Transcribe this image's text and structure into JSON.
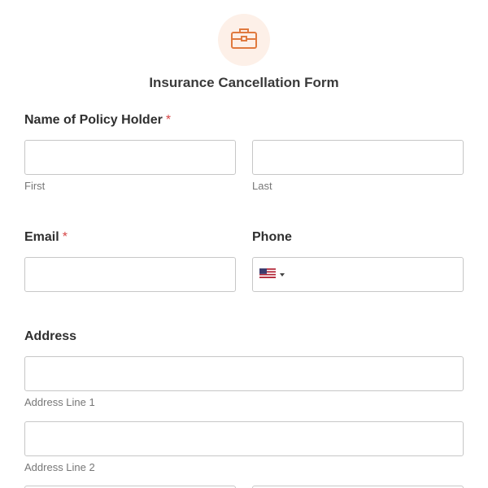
{
  "header": {
    "logo_icon": "briefcase-icon",
    "title": "Insurance Cancellation Form",
    "accent_color": "#e07a3f"
  },
  "policy_holder": {
    "label": "Name of Policy Holder",
    "required_mark": "*",
    "first": {
      "value": "",
      "sublabel": "First"
    },
    "last": {
      "value": "",
      "sublabel": "Last"
    }
  },
  "email": {
    "label": "Email",
    "required_mark": "*",
    "value": ""
  },
  "phone": {
    "label": "Phone",
    "country_icon": "us-flag-icon",
    "value": ""
  },
  "address": {
    "label": "Address",
    "line1": {
      "value": "",
      "sublabel": "Address Line 1"
    },
    "line2": {
      "value": "",
      "sublabel": "Address Line 2"
    }
  }
}
